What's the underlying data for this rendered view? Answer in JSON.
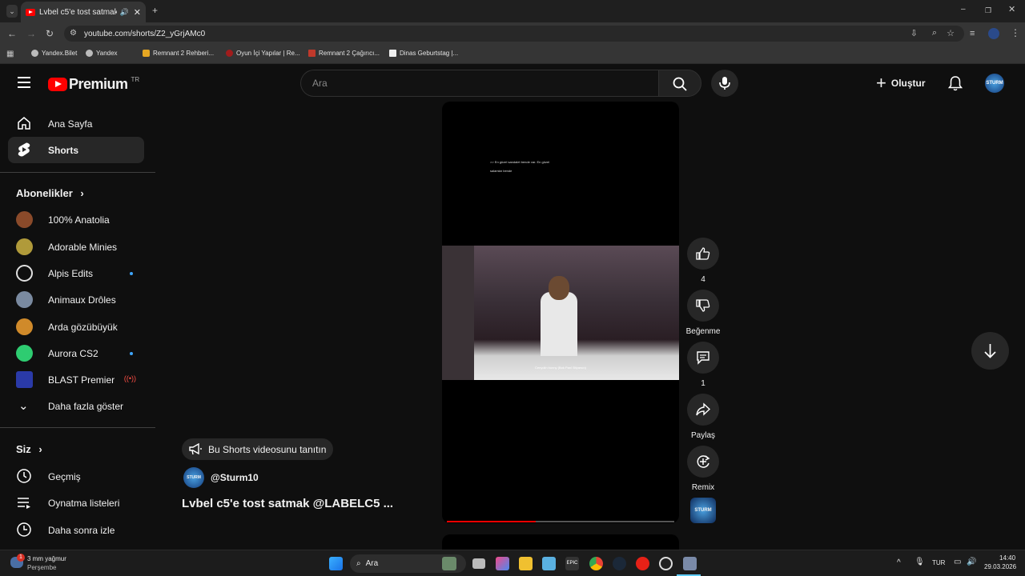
{
  "browser": {
    "tab_title": "Lvbel c5'e tost satmak @LA",
    "url": "youtube.com/shorts/Z2_yGrjAMc0",
    "bookmarks": [
      "Yandex.Bilet",
      "Yandex",
      "Remnant 2 Rehberi...",
      "Oyun İçi Yapılar | Re...",
      "Remnant 2 Çağırıcı...",
      "Dinas Geburtstag |..."
    ]
  },
  "youtube": {
    "logo": "Premium",
    "region": "TR",
    "search_placeholder": "Ara",
    "create_label": "Oluştur",
    "nav": [
      {
        "label": "Ana Sayfa",
        "icon": "home-icon"
      },
      {
        "label": "Shorts",
        "icon": "shorts-icon"
      }
    ],
    "subscriptions_title": "Abonelikler",
    "subscriptions": [
      {
        "name": "100% Anatolia",
        "color": "#8a4a2a",
        "dot": false
      },
      {
        "name": "Adorable Minies",
        "color": "#b09a3a",
        "dot": false
      },
      {
        "name": "Alpis Edits",
        "color": "#e0e0e0",
        "dot": true
      },
      {
        "name": "Animaux Drôles",
        "color": "#7a8aa0",
        "dot": false
      },
      {
        "name": "Arda gözübüyük",
        "color": "#d08a2a",
        "dot": false
      },
      {
        "name": "Aurora CS2",
        "color": "#2ecc71",
        "dot": true
      },
      {
        "name": "BLAST Premier",
        "color": "#2a3aa8",
        "dot": false,
        "live": true
      }
    ],
    "show_more": "Daha fazla göster",
    "you_title": "Siz",
    "you_items": [
      "Geçmiş",
      "Oynatma listeleri",
      "Daha sonra izle"
    ],
    "short": {
      "caption_line1": ">> En güzel sandalet bende var. En güzel",
      "caption_line2": "salamlar bende",
      "subtitle": "Cenyolin bunny (Bok Parıl Bilyarsın)",
      "promo": "Bu Shorts videosunu tanıtın",
      "channel": "@Sturm10",
      "title": "Lvbel c5'e tost satmak @LABELC5 ...",
      "progress": 0.39
    },
    "actions": {
      "likes": "4",
      "dislike": "Beğenme",
      "comments": "1",
      "share": "Paylaş",
      "remix": "Remix"
    }
  },
  "taskbar": {
    "weather_temp": "3 mm yağmur",
    "weather_day": "Perşembe",
    "search": "Ara",
    "lang": "TUR",
    "time": "14:40",
    "date": "29.03.2026",
    "notification": "1"
  }
}
